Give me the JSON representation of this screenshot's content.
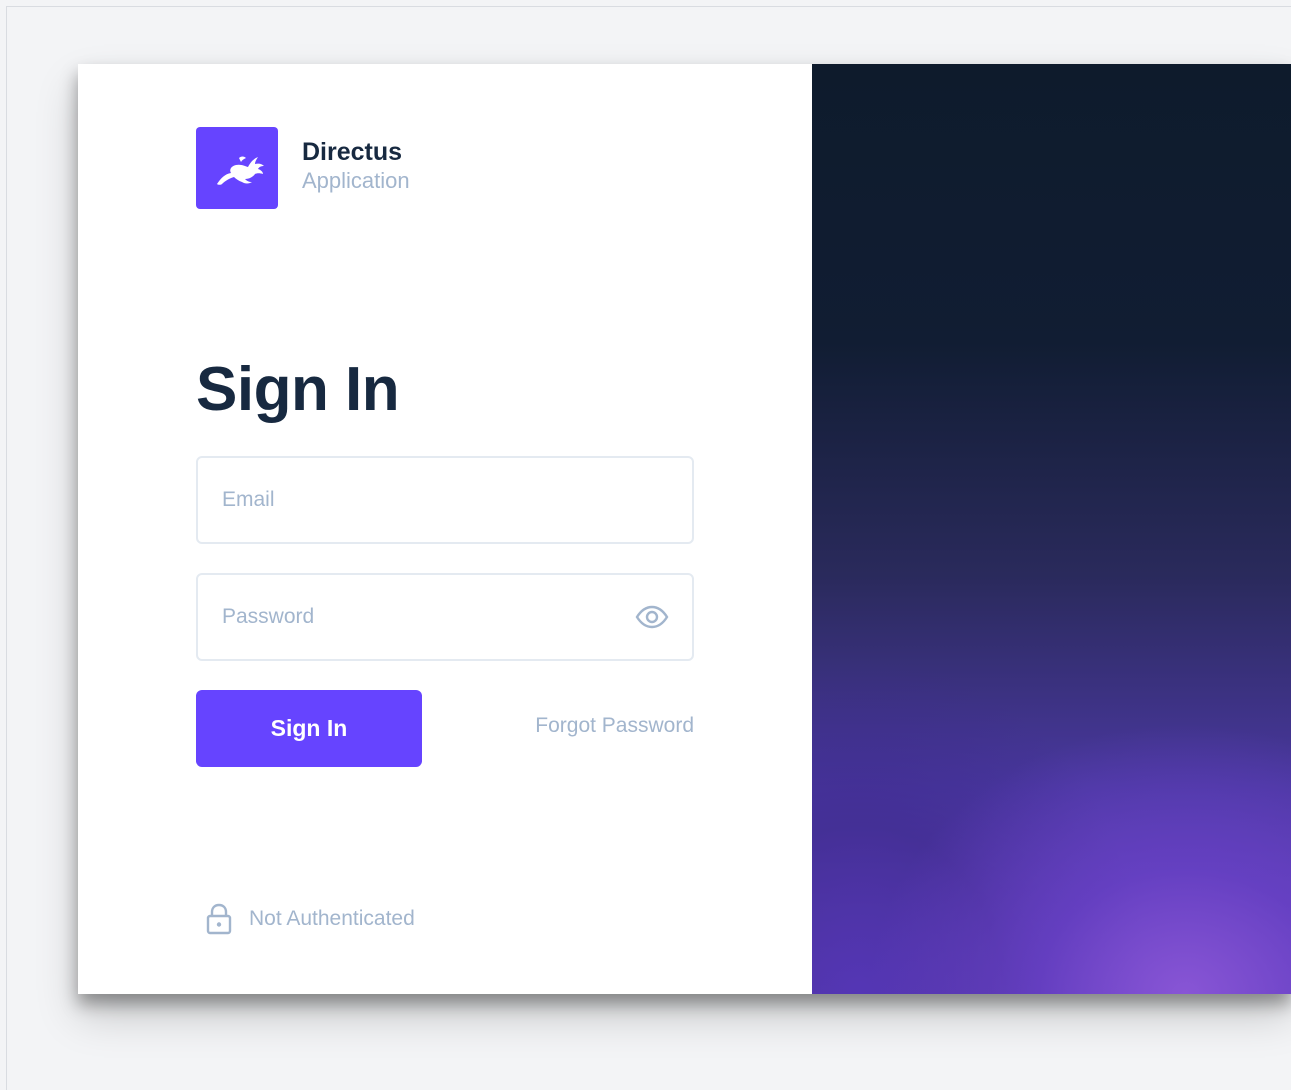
{
  "brand": {
    "name": "Directus",
    "subtitle": "Application",
    "logo_icon": "rabbit-logo-icon",
    "accent_color": "#6644ff"
  },
  "page": {
    "title": "Sign In"
  },
  "form": {
    "email": {
      "value": "",
      "placeholder": "Email"
    },
    "password": {
      "value": "",
      "placeholder": "Password",
      "toggle_icon": "eye-icon"
    },
    "submit_label": "Sign In",
    "forgot_password_label": "Forgot Password"
  },
  "status": {
    "icon": "lock-icon",
    "text": "Not Authenticated"
  },
  "colors": {
    "text_dark": "#172940",
    "text_muted": "#a2b5cd",
    "border": "#e4eaf1",
    "background": "#f3f4f6"
  }
}
